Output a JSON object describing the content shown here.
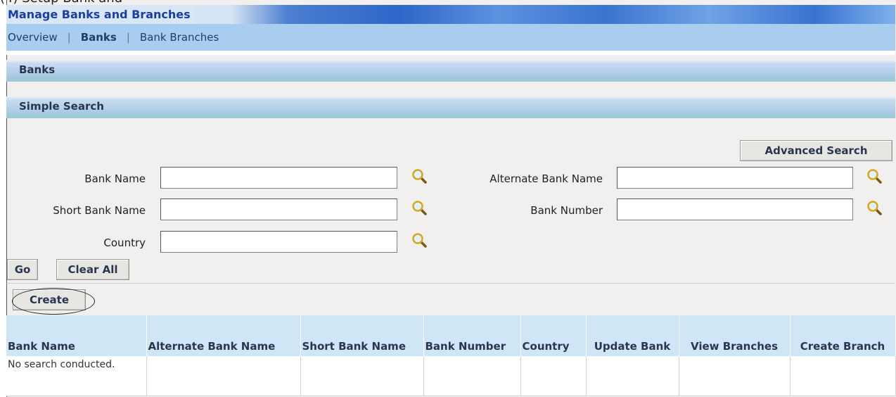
{
  "page": {
    "cropped_caption": "(4) Setup Bank and",
    "title": "Manage Banks and Branches"
  },
  "subnav": {
    "items": [
      {
        "label": "Overview",
        "active": false
      },
      {
        "label": "Banks",
        "active": true
      },
      {
        "label": "Bank Branches",
        "active": false
      }
    ],
    "separator": "|"
  },
  "sections": {
    "banks_header": "Banks",
    "simple_search_header": "Simple Search"
  },
  "search": {
    "advanced_search_label": "Advanced Search",
    "fields": {
      "bank_name": {
        "label": "Bank Name",
        "value": ""
      },
      "alternate_bank_name": {
        "label": "Alternate Bank Name",
        "value": ""
      },
      "short_bank_name": {
        "label": "Short Bank Name",
        "value": ""
      },
      "bank_number": {
        "label": "Bank Number",
        "value": ""
      },
      "country": {
        "label": "Country",
        "value": ""
      }
    },
    "go_label": "Go",
    "clear_all_label": "Clear All"
  },
  "actions": {
    "create_label": "Create"
  },
  "results": {
    "columns": [
      "Bank Name",
      "Alternate Bank Name",
      "Short Bank Name",
      "Bank Number",
      "Country",
      "Update Bank",
      "View Branches",
      "Create Branch"
    ],
    "empty_message": "No search conducted."
  },
  "icons": {
    "search": "magnifier-icon"
  },
  "colors": {
    "subnav_bg": "#a9cdef",
    "section_header_text": "#2a3550",
    "table_header_bg": "#cfe6f7",
    "page_bg": "#f1f0ef"
  }
}
